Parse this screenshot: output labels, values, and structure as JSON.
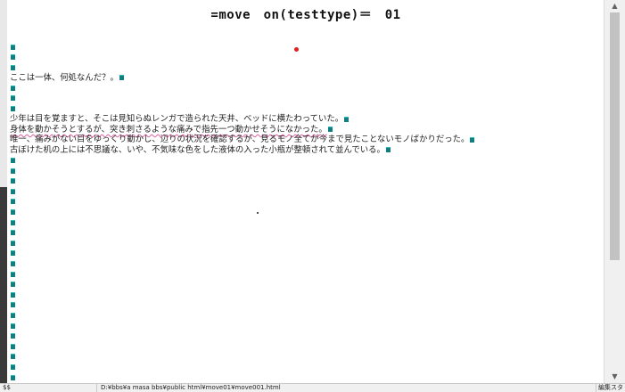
{
  "title": "=move　on(testtype)＝　01",
  "lines": [
    "",
    "",
    "",
    "ここは一体、何処なんだ？。",
    "",
    "",
    "",
    "少年は目を覚ますと、そこは見知らぬレンガで造られた天井、ベッドに横たわっていた。",
    "身体を動かそうとするが、突き刺さるような痛みで指先一つ動かせそうになかった。",
    "唯一、痛みがない目をゆっくり動かし、辺りの状況を確認するが、見るモノ全てが今まで見たことないモノばかりだった。",
    "古ぼけた机の上には不思議な、いや、不気味な色をした液体の入った小瓶が整頓されて並んでいる。",
    "",
    "",
    "",
    "",
    "",
    "",
    "",
    "",
    "",
    "",
    "",
    "",
    "",
    "",
    "",
    "",
    "",
    "",
    "",
    "",
    "",
    ""
  ],
  "status": {
    "left": "$$",
    "path": "D:¥bbs¥a masa bbs¥public html¥move01¥move001.html",
    "mode": "編集スタ"
  },
  "colors": {
    "eol_mark": "#0f7f80",
    "underline": "#e060a0",
    "cursor_dot": "#e02020"
  }
}
